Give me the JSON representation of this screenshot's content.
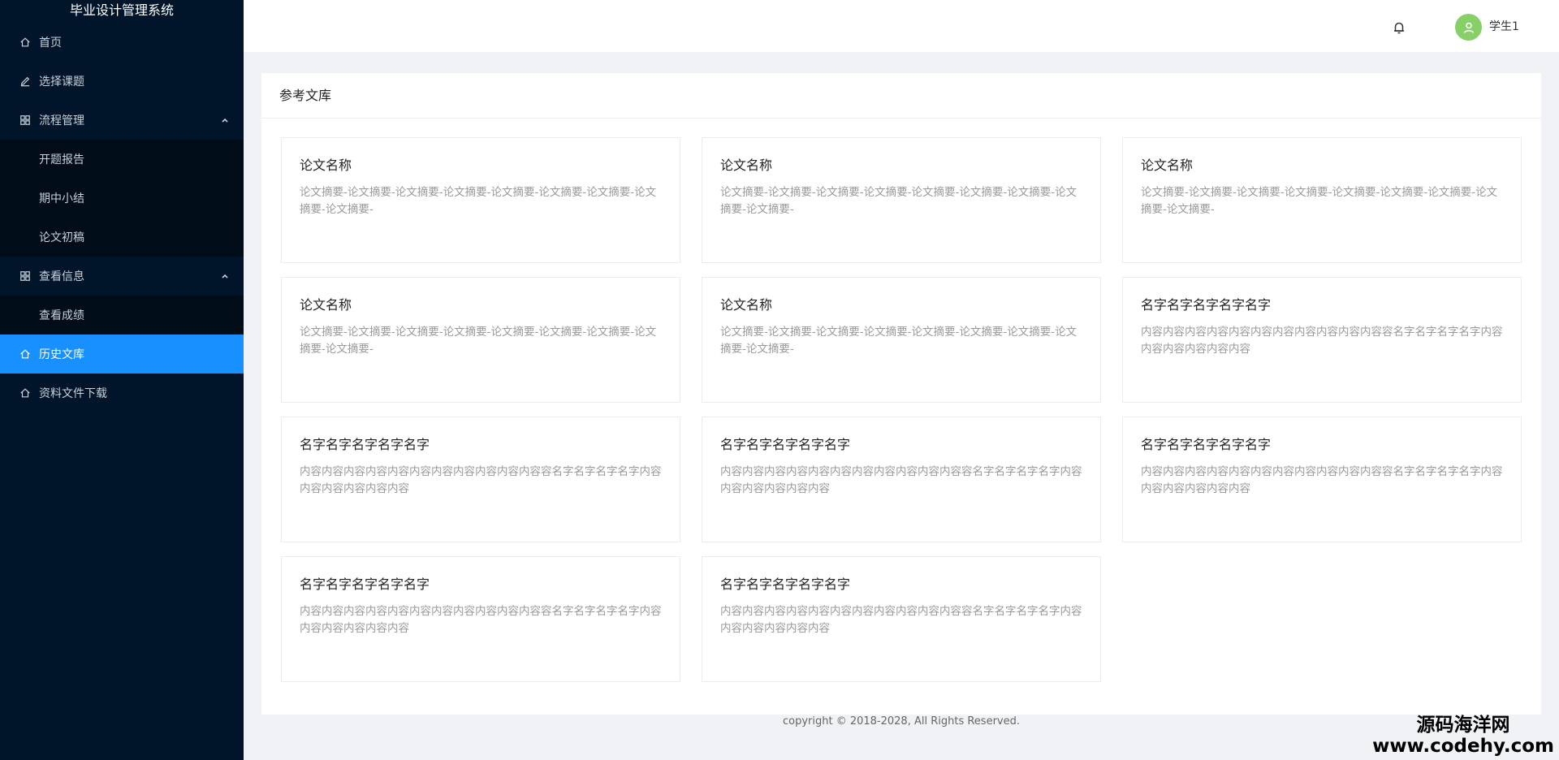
{
  "app": {
    "title": "毕业设计管理系统"
  },
  "sidebar": {
    "items": [
      {
        "label": "首页",
        "icon": "home-icon"
      },
      {
        "label": "选择课题",
        "icon": "edit-icon"
      },
      {
        "label": "流程管理",
        "icon": "grid-icon",
        "expanded": true,
        "children": [
          {
            "label": "开题报告"
          },
          {
            "label": "期中小结"
          },
          {
            "label": "论文初稿"
          }
        ]
      },
      {
        "label": "查看信息",
        "icon": "grid-icon",
        "expanded": true,
        "children": [
          {
            "label": "查看成绩"
          }
        ]
      },
      {
        "label": "历史文库",
        "icon": "home-icon",
        "active": true
      },
      {
        "label": "资料文件下载",
        "icon": "home-icon"
      }
    ]
  },
  "header": {
    "username": "学生1",
    "bell_icon": "bell-icon",
    "avatar_icon": "user-icon",
    "avatar_color": "#87d068"
  },
  "main": {
    "title": "参考文库",
    "cards": [
      {
        "title": "论文名称",
        "desc": "论文摘要-论文摘要-论文摘要-论文摘要-论文摘要-论文摘要-论文摘要-论文摘要-论文摘要-"
      },
      {
        "title": "论文名称",
        "desc": "论文摘要-论文摘要-论文摘要-论文摘要-论文摘要-论文摘要-论文摘要-论文摘要-论文摘要-"
      },
      {
        "title": "论文名称",
        "desc": "论文摘要-论文摘要-论文摘要-论文摘要-论文摘要-论文摘要-论文摘要-论文摘要-论文摘要-"
      },
      {
        "title": "论文名称",
        "desc": "论文摘要-论文摘要-论文摘要-论文摘要-论文摘要-论文摘要-论文摘要-论文摘要-论文摘要-"
      },
      {
        "title": "论文名称",
        "desc": "论文摘要-论文摘要-论文摘要-论文摘要-论文摘要-论文摘要-论文摘要-论文摘要-论文摘要-"
      },
      {
        "title": "名字名字名字名字名字",
        "desc": "内容内容内容内容内容内容内容内容内容内容内容容名字名字名字名字内容内容内容内容内容内容"
      },
      {
        "title": "名字名字名字名字名字",
        "desc": "内容内容内容内容内容内容内容内容内容内容内容容名字名字名字名字内容内容内容内容内容内容"
      },
      {
        "title": "名字名字名字名字名字",
        "desc": "内容内容内容内容内容内容内容内容内容内容内容容名字名字名字名字内容内容内容内容内容内容"
      },
      {
        "title": "名字名字名字名字名字",
        "desc": "内容内容内容内容内容内容内容内容内容内容内容容名字名字名字名字内容内容内容内容内容内容"
      },
      {
        "title": "名字名字名字名字名字",
        "desc": "内容内容内容内容内容内容内容内容内容内容内容容名字名字名字名字内容内容内容内容内容内容"
      },
      {
        "title": "名字名字名字名字名字",
        "desc": "内容内容内容内容内容内容内容内容内容内容内容容名字名字名字名字内容内容内容内容内容内容"
      }
    ]
  },
  "footer": {
    "copyright": "copyright © 2018-2028, All Rights Reserved."
  },
  "watermark": {
    "line1": "源码海洋网",
    "line2": "www.codehy.com"
  },
  "colors": {
    "sidebar_bg": "#001529",
    "submenu_bg": "#000c17",
    "active": "#1890ff",
    "page_bg": "#f0f2f5"
  }
}
